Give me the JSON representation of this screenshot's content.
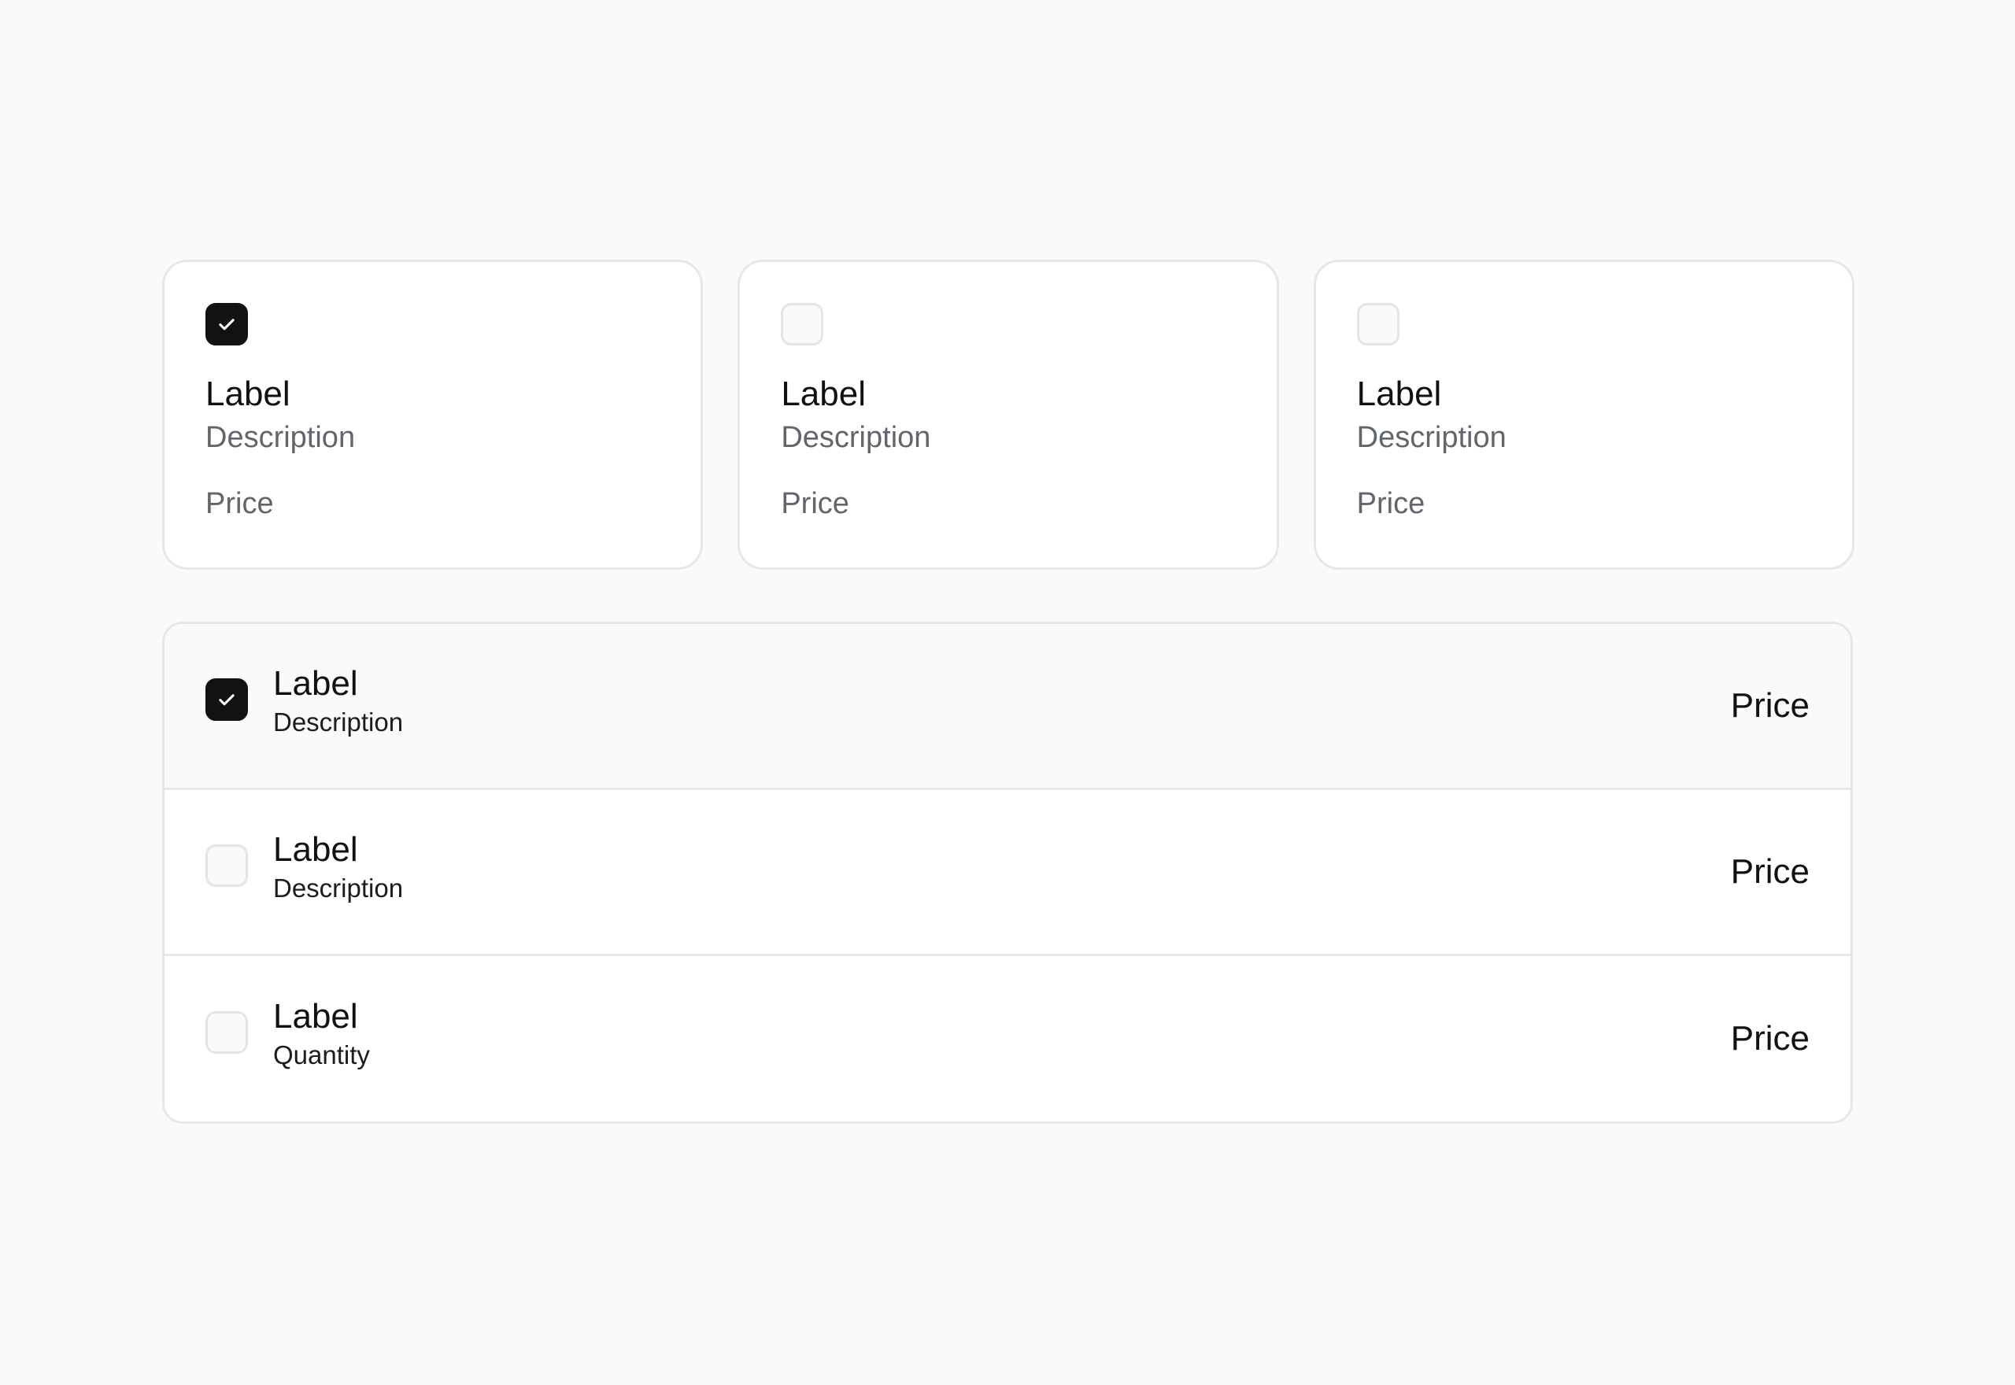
{
  "colors": {
    "background": "#f9fafa",
    "card": "#ffffff",
    "border": "#e6e8e8",
    "checked": "#121212",
    "text": "#111111",
    "muted": "#60666b"
  },
  "cards": [
    {
      "checked": true,
      "label": "Label",
      "description": "Description",
      "price": "Price"
    },
    {
      "checked": false,
      "label": "Label",
      "description": "Description",
      "price": "Price"
    },
    {
      "checked": false,
      "label": "Label",
      "description": "Description",
      "price": "Price"
    }
  ],
  "list": [
    {
      "checked": true,
      "label": "Label",
      "description": "Description",
      "price": "Price"
    },
    {
      "checked": false,
      "label": "Label",
      "description": "Description",
      "price": "Price"
    },
    {
      "checked": false,
      "label": "Label",
      "description": "Quantity",
      "price": "Price"
    }
  ],
  "icons": {
    "check": "check-icon"
  }
}
